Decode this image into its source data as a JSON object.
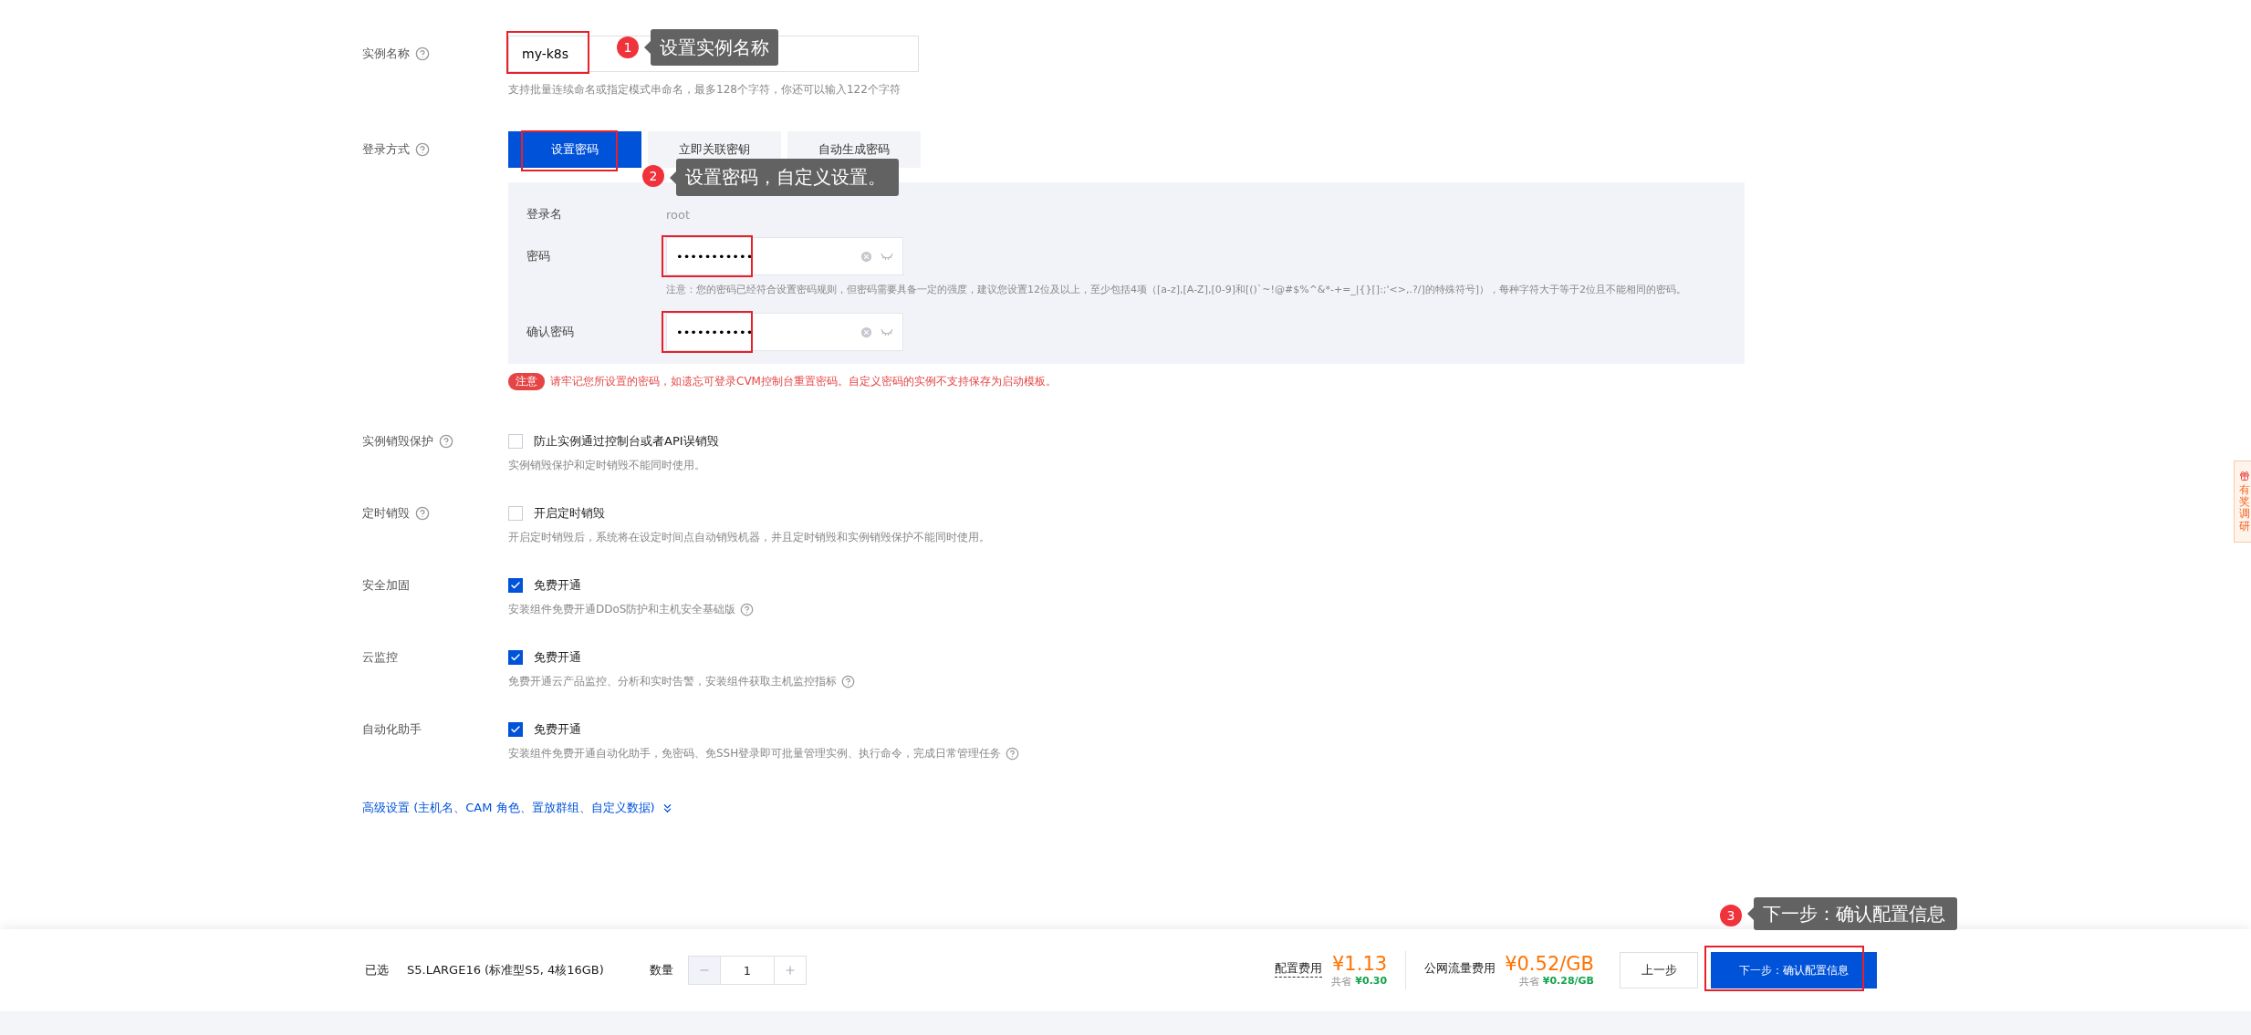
{
  "instance_name": {
    "label": "实例名称",
    "help": true,
    "value": "my-k8s",
    "highlighted": true,
    "hint": "支持批量连续命名或指定模式串命名，最多128个字符，你还可以输入122个字符",
    "annotation": {
      "number": "1",
      "text": "设置实例名称"
    }
  },
  "login": {
    "label": "登录方式",
    "help": true,
    "tabs": [
      {
        "label": "设置密码",
        "selected": true,
        "highlighted": true
      },
      {
        "label": "立即关联密钥",
        "selected": false,
        "highlighted": false
      },
      {
        "label": "自动生成密码",
        "selected": false,
        "highlighted": false
      }
    ],
    "annotation": {
      "number": "2",
      "text": "设置密码，自定义设置。"
    },
    "fields": [
      {
        "kind": "static",
        "label": "登录名",
        "value": "root"
      },
      {
        "kind": "password",
        "label": "密码",
        "value": "•••••••••••",
        "highlighted": true,
        "note": "注意：您的密码已经符合设置密码规则，但密码需要具备一定的强度，建议您设置12位及以上，至少包括4项（[a-z],[A-Z],[0-9]和[()`~!@#$%^&*-+=_|{}[]:;'<>,.?/]的特殊符号]），每种字符大于等于2位且不能相同的密码。"
      },
      {
        "kind": "password",
        "label": "确认密码",
        "value": "•••••••••••",
        "highlighted": true
      }
    ],
    "notice": {
      "tag": "注意",
      "text": "请牢记您所设置的密码，如遗忘可登录CVM控制台重置密码。自定义密码的实例不支持保存为启动模板。"
    }
  },
  "options": [
    {
      "label": "实例销毁保护",
      "help": true,
      "option": "防止实例通过控制台或者API误销毁",
      "checked": false,
      "description": "实例销毁保护和定时销毁不能同时使用。",
      "description_help": false
    },
    {
      "label": "定时销毁",
      "help": true,
      "option": "开启定时销毁",
      "checked": false,
      "description": "开启定时销毁后，系统将在设定时间点自动销毁机器，并且定时销毁和实例销毁保护不能同时使用。",
      "description_help": false
    },
    {
      "label": "安全加固",
      "help": false,
      "option": "免费开通",
      "checked": true,
      "description": "安装组件免费开通DDoS防护和主机安全基础版",
      "description_help": true
    },
    {
      "label": "云监控",
      "help": false,
      "option": "免费开通",
      "checked": true,
      "description": "免费开通云产品监控、分析和实时告警，安装组件获取主机监控指标",
      "description_help": true
    },
    {
      "label": "自动化助手",
      "help": false,
      "option": "免费开通",
      "checked": true,
      "description": "安装组件免费开通自动化助手，免密码、免SSH登录即可批量管理实例、执行命令，完成日常管理任务",
      "description_help": true
    }
  ],
  "advanced_link": "高级设置 (主机名、CAM 角色、置放群组、自定义数据)",
  "footer": {
    "selected_label": "已选",
    "selected_value": "S5.LARGE16 (标准型S5, 4核16GB)",
    "quantity_label": "数量",
    "quantity": "1",
    "config_fee": {
      "label": "配置费用",
      "price": "¥1.13",
      "save_label": "共省",
      "save": "¥0.30"
    },
    "traffic_fee": {
      "label": "公网流量费用",
      "price": "¥0.52/GB",
      "save_label": "共省",
      "save": "¥0.28/GB"
    },
    "prev_button": "上一步",
    "next_button": {
      "label": "下一步：确认配置信息",
      "highlighted": true
    },
    "annotation": {
      "number": "3",
      "text": "下一步：确认配置信息"
    }
  },
  "side_tab": "有奖调研"
}
